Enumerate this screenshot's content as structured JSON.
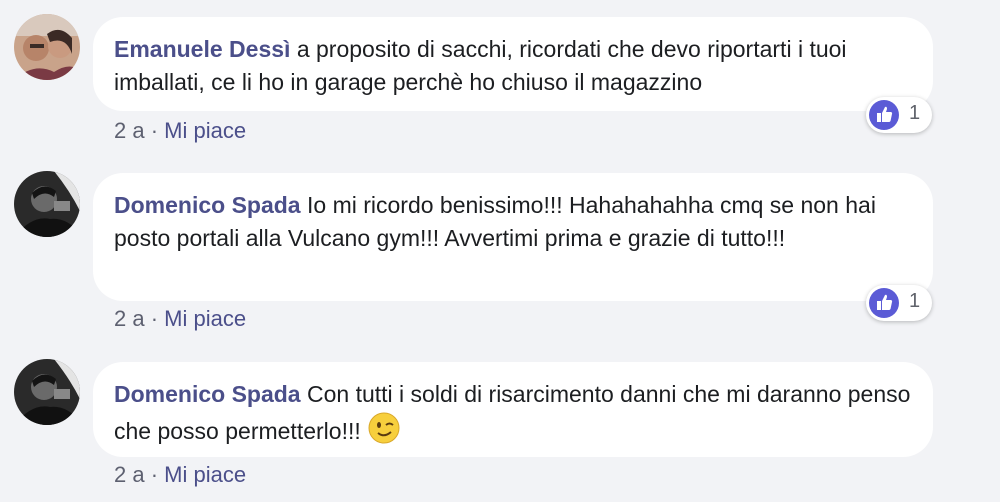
{
  "comments": [
    {
      "author": "Emanuele Dessì",
      "text": "a proposito di sacchi, ricordati che devo riportarti i tuoi imballati, ce li ho in garage perchè ho chiuso il magazzino",
      "time": "2 a",
      "separator": "·",
      "like_label": "Mi piace",
      "reactions": {
        "icon": "thumbs-up-icon",
        "count": "1"
      }
    },
    {
      "author": "Domenico Spada",
      "text": "Io mi ricordo benissimo!!! Hahahahahha cmq se non hai posto portali alla Vulcano gym!!! Avvertimi prima e grazie di tutto!!!",
      "time": "2 a",
      "separator": "·",
      "like_label": "Mi piace",
      "reactions": {
        "icon": "thumbs-up-icon",
        "count": "1"
      }
    },
    {
      "author": "Domenico Spada",
      "text": "Con tutti i soldi di risarcimento danni che mi daranno penso che posso permetterlo!!!",
      "emoji": "wink-emoji-icon",
      "time": "2 a",
      "separator": "·",
      "like_label": "Mi piace"
    }
  ],
  "colors": {
    "background": "#f2f3f6",
    "bubble": "#ffffff",
    "author": "#4b4f8a",
    "reaction": "#5b5bd6"
  }
}
